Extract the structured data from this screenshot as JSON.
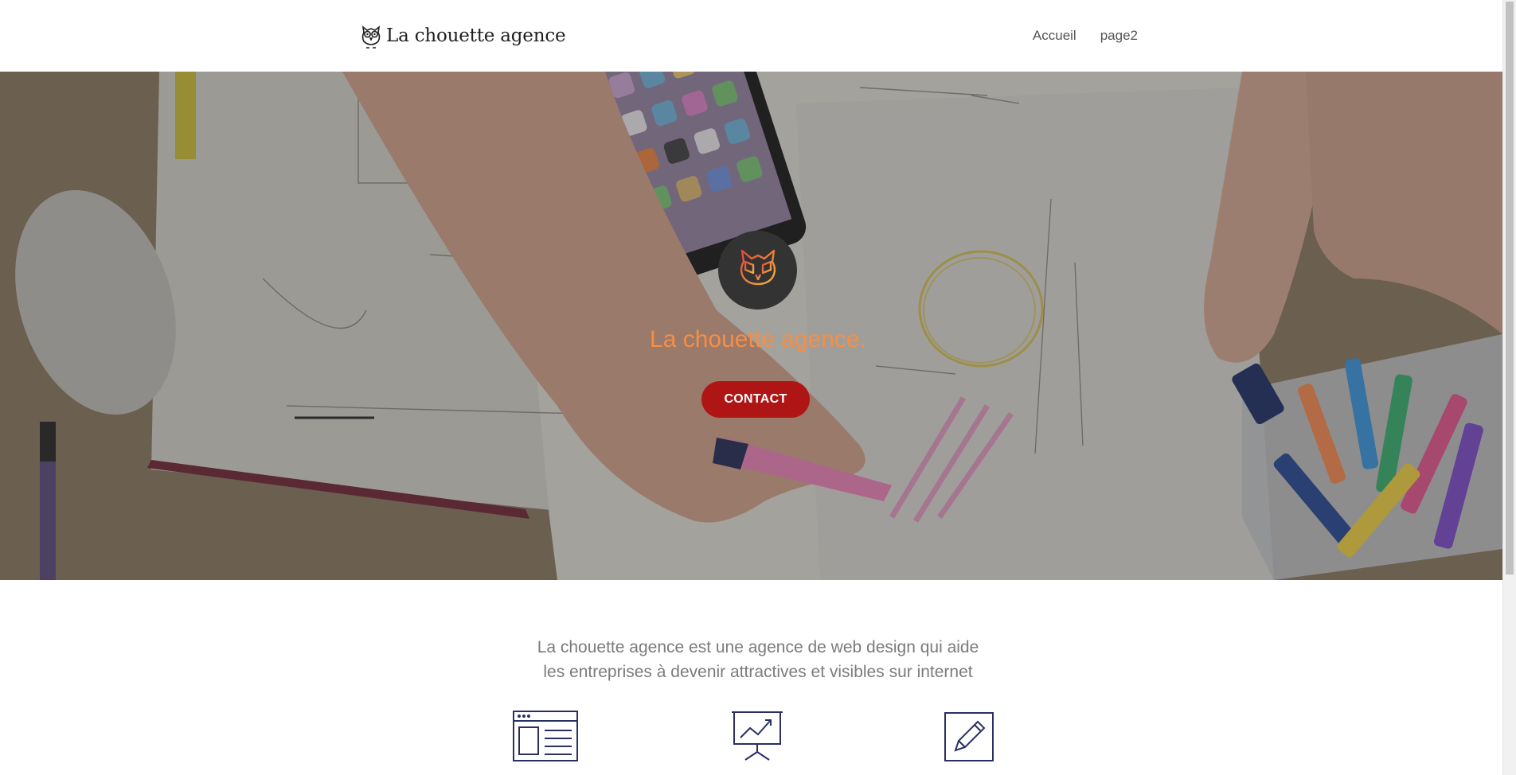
{
  "header": {
    "brand_name": "La chouette agence",
    "brand_icon": "owl-icon",
    "nav": [
      {
        "label": "Accueil"
      },
      {
        "label": "page2"
      }
    ]
  },
  "hero": {
    "logo_icon": "owl-icon",
    "title": "La chouette agence.",
    "cta_label": "CONTACT",
    "colors": {
      "title": "#f78e44",
      "cta_background": "#b01515",
      "logo_circle": "#333333"
    }
  },
  "intro": {
    "line1": "La chouette agence est une agence de web design qui aide",
    "line2": "les entreprises à devenir attractives et visibles sur internet"
  },
  "services": {
    "icons": [
      "web-layout-icon",
      "presentation-chart-icon",
      "pencil-edit-icon"
    ],
    "icon_color": "#2a2f63"
  }
}
